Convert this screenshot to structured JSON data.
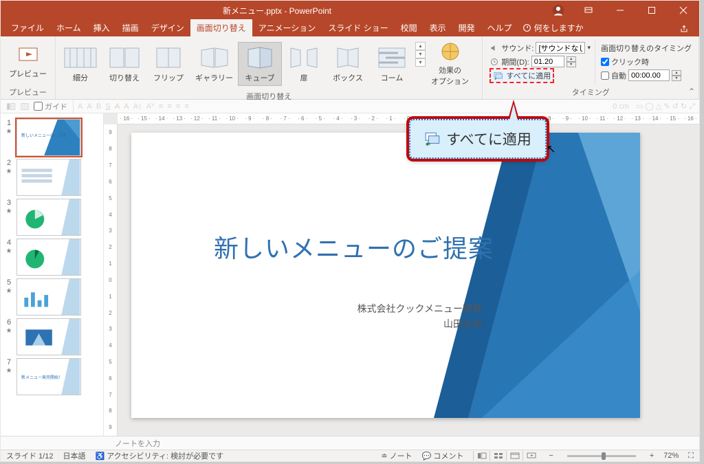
{
  "title": "新メニュー.pptx  -  PowerPoint",
  "tabs": [
    "ファイル",
    "ホーム",
    "挿入",
    "描画",
    "デザイン",
    "画面切り替え",
    "アニメーション",
    "スライド ショー",
    "校閲",
    "表示",
    "開発",
    "ヘルプ"
  ],
  "activeTab": 5,
  "tell_me": "何をしますか",
  "share_label": "共有",
  "ribbon": {
    "preview": {
      "label": "プレビュー",
      "btn": "プレビュー"
    },
    "transitions": {
      "label": "画面切り替え",
      "items": [
        "細分",
        "切り替え",
        "フリップ",
        "ギャラリー",
        "キューブ",
        "扉",
        "ボックス",
        "コーム"
      ],
      "selected": 4,
      "options": "効果の\nオプション"
    },
    "timing": {
      "label": "タイミング",
      "sound_label": "サウンド:",
      "sound_value": "[サウンドなし]",
      "duration_label": "期間(D):",
      "duration_value": "01.20",
      "apply_all": "すべてに適用",
      "advance_label": "画面切り替えのタイミング",
      "on_click": "クリック時",
      "on_click_checked": true,
      "auto_label": "自動",
      "auto_checked": false,
      "auto_value": "00:00.00"
    }
  },
  "guide_label": "ガイド",
  "hruler": [
    "16",
    "15",
    "14",
    "13",
    "12",
    "11",
    "10",
    "9",
    "8",
    "7",
    "6",
    "5",
    "4",
    "3",
    "2",
    "1",
    "0",
    "1",
    "2",
    "3",
    "4",
    "5",
    "6",
    "7",
    "8",
    "9",
    "10",
    "11",
    "12",
    "13",
    "14",
    "15",
    "16"
  ],
  "vruler": [
    "9",
    "8",
    "7",
    "6",
    "5",
    "4",
    "3",
    "2",
    "1",
    "0",
    "1",
    "2",
    "3",
    "4",
    "5",
    "6",
    "7",
    "8",
    "9"
  ],
  "slide": {
    "title": "新しいメニューのご提案",
    "sub1": "株式会社クックメニュー開発",
    "sub2": "山田太郎"
  },
  "ruler_unit": "0 cm",
  "notes_placeholder": "ノートを入力",
  "status": {
    "slide": "スライド 1/12",
    "lang": "日本語",
    "acc": "アクセシビリティ: 検討が必要です",
    "notes_btn": "ノート",
    "comments_btn": "コメント",
    "zoom": "72%"
  },
  "callout_text": "すべてに適用",
  "thumbs": [
    1,
    2,
    3,
    4,
    5,
    6,
    7
  ]
}
